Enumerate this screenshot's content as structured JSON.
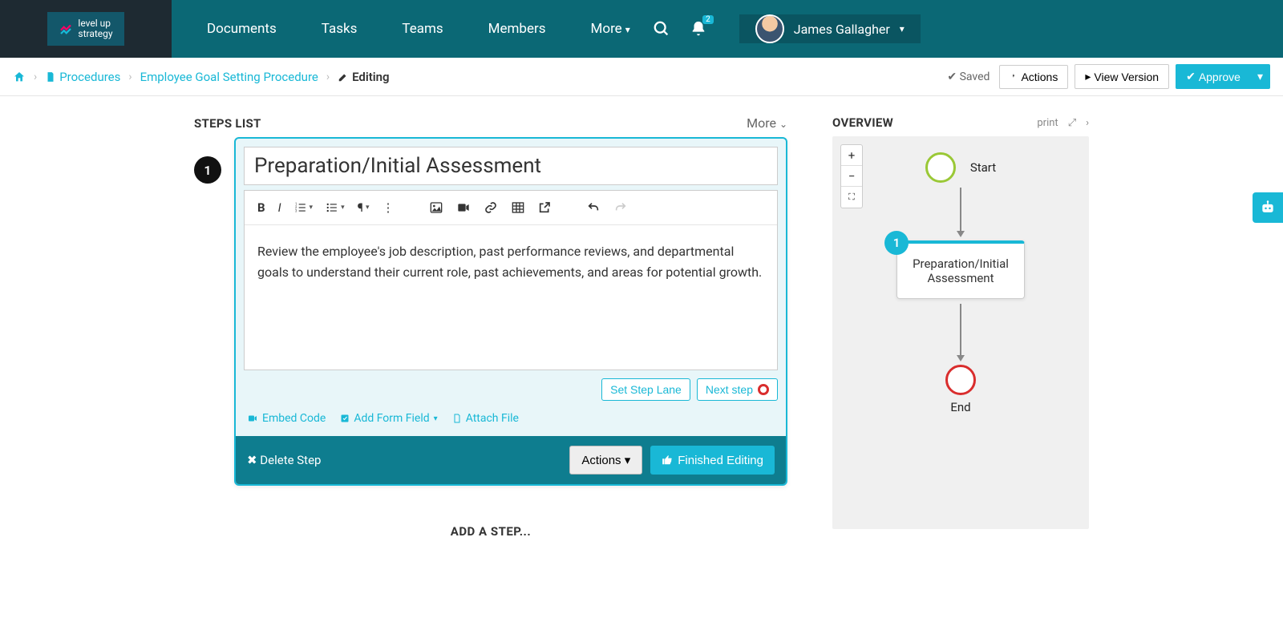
{
  "logo": {
    "line1": "level up",
    "line2": "strategy"
  },
  "nav": {
    "items": [
      "Documents",
      "Tasks",
      "Teams",
      "Members",
      "More"
    ]
  },
  "notif_count": "2",
  "user": {
    "name": "James Gallagher"
  },
  "breadcrumb": {
    "procedures": "Procedures",
    "doc_title": "Employee Goal Setting Procedure",
    "editing": "Editing"
  },
  "crumb_actions": {
    "saved": "Saved",
    "actions": "Actions",
    "view_version": "View Version",
    "approve": "Approve"
  },
  "steps_panel": {
    "title": "STEPS LIST",
    "more": "More"
  },
  "step": {
    "number": "1",
    "title": "Preparation/Initial Assessment",
    "body": "Review the employee's job description, past performance reviews, and departmental goals to understand their current role, past achievements, and areas for potential growth.",
    "set_lane": "Set Step Lane",
    "next_step": "Next step",
    "embed_code": "Embed Code",
    "add_form_field": "Add Form Field",
    "attach_file": "Attach File",
    "delete": "Delete Step",
    "actions": "Actions",
    "finished": "Finished Editing"
  },
  "add_step": "ADD A STEP...",
  "overview": {
    "title": "OVERVIEW",
    "print": "print",
    "start": "Start",
    "node_title": "Preparation/Initial Assessment",
    "node_num": "1",
    "end": "End"
  }
}
